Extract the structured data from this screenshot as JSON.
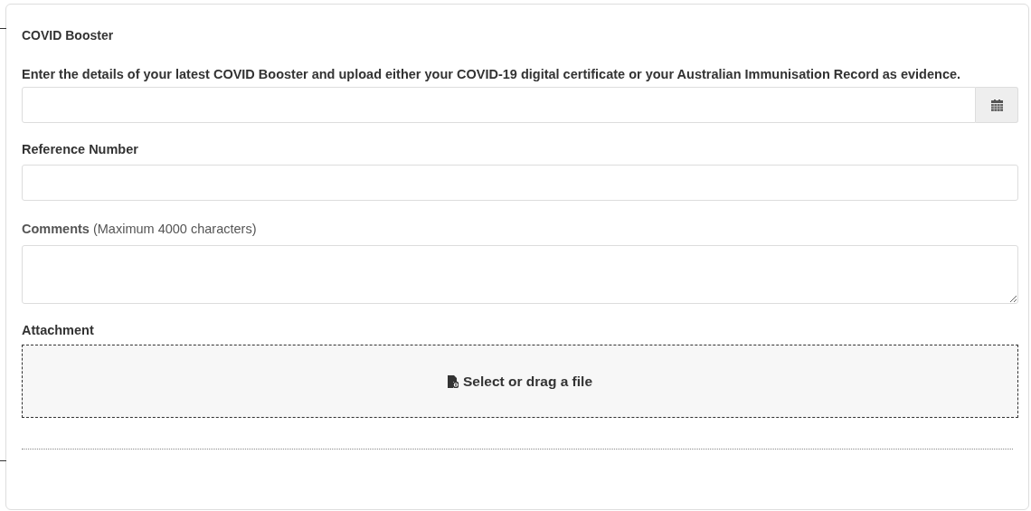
{
  "section": {
    "title": "COVID Booster",
    "intro": "Enter the details of your latest COVID Booster and upload either your COVID-19 digital certificate or your Australian Immunisation Record as evidence.",
    "fields": [
      {
        "kind": "date"
      },
      {
        "kind": "text",
        "label": "Reference Number"
      },
      {
        "kind": "textarea",
        "label": "**Comments** (Maximum 4000 characters)"
      },
      {
        "kind": "file",
        "label": "Attachment",
        "button": "Select or drag a file"
      }
    ]
  }
}
